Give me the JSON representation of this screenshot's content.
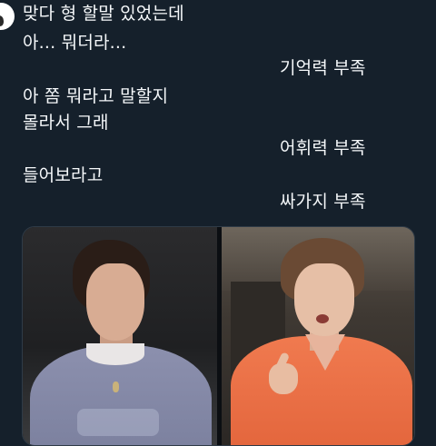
{
  "tweet": {
    "lines_left": [
      "맞다 형 할말 있었는데",
      "아... 뭐더라...",
      "아 쫌 뭐라고 말할지",
      "몰라서 그래",
      "들어보라고"
    ],
    "lines_right": [
      "기억력 부족",
      "어휘력 부족",
      "싸가지 부족"
    ]
  },
  "colors": {
    "background": "#15202b",
    "text": "#f5f8fa",
    "border": "#2f3b47"
  }
}
